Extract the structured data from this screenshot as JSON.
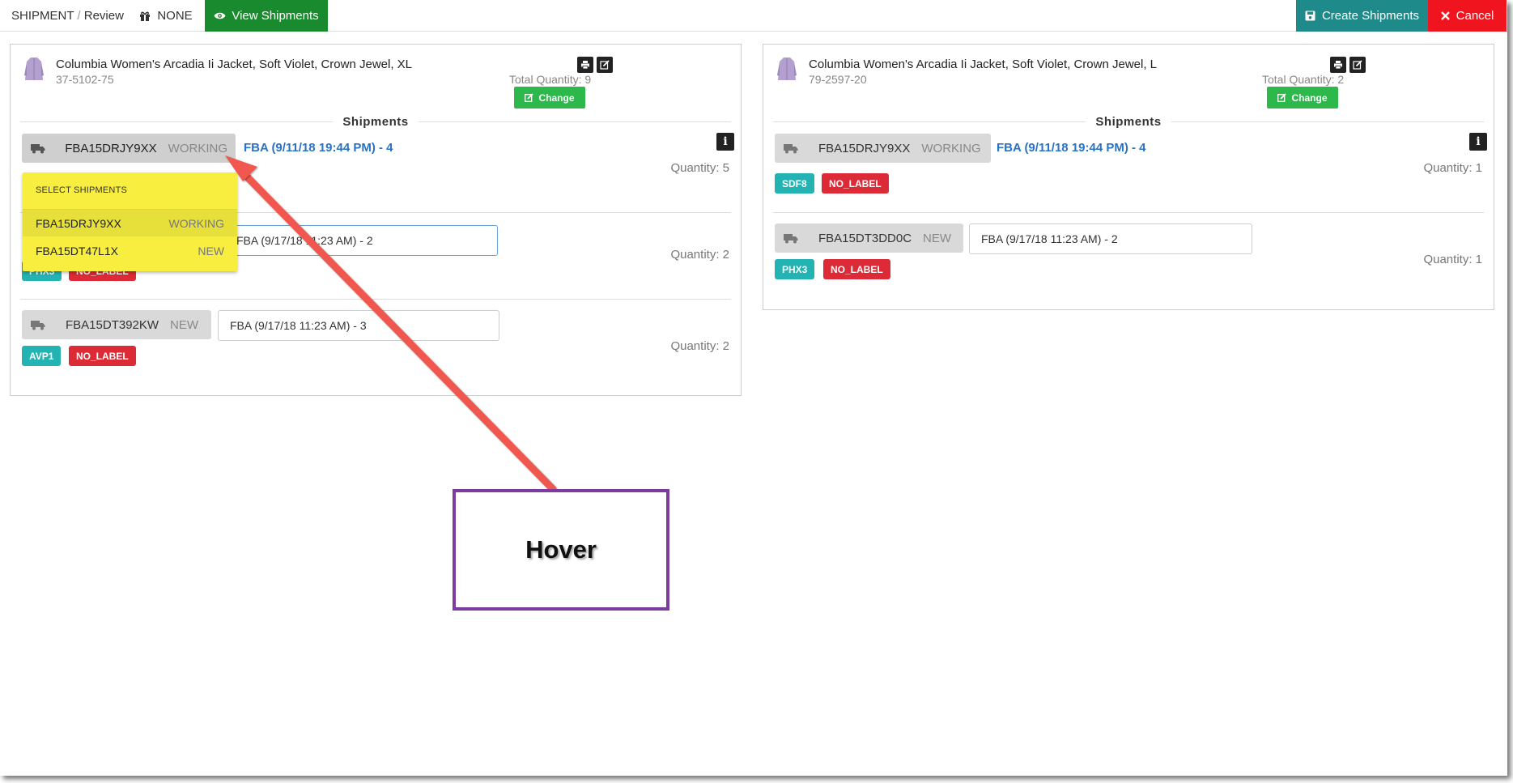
{
  "topbar": {
    "crumb_root": "SHIPMENT",
    "crumb_sep": "/",
    "crumb_current": "Review",
    "none_label": "NONE",
    "view_label": "View Shipments",
    "create_label": "Create Shipments",
    "cancel_label": "Cancel"
  },
  "panels": [
    {
      "title": "Columbia Women's Arcadia Ii Jacket, Soft Violet, Crown Jewel, XL",
      "sku": "37-5102-75",
      "total_qty": "Total Quantity: 9",
      "change_label": "Change",
      "section": "Shipments",
      "rows": [
        {
          "id": "FBA15DRJY9XX",
          "status": "WORKING",
          "link": "FBA (9/11/18 19:44 PM) - 4",
          "qty": "Quantity: 5",
          "tags": []
        },
        {
          "id": "",
          "status": "",
          "input": "FBA (9/17/18 11:23 AM) - 2",
          "qty": "Quantity: 2",
          "tags": [
            "PHX3",
            "NO_LABEL"
          ]
        },
        {
          "id": "FBA15DT392KW",
          "status": "NEW",
          "input": "FBA (9/17/18 11:23 AM) - 3",
          "qty": "Quantity: 2",
          "tags": [
            "AVP1",
            "NO_LABEL"
          ]
        }
      ]
    },
    {
      "title": "Columbia Women's Arcadia Ii Jacket, Soft Violet, Crown Jewel, L",
      "sku": "79-2597-20",
      "total_qty": "Total Quantity: 2",
      "change_label": "Change",
      "section": "Shipments",
      "rows": [
        {
          "id": "FBA15DRJY9XX",
          "status": "WORKING",
          "link": "FBA (9/11/18 19:44 PM) - 4",
          "qty": "Quantity: 1",
          "tags": [
            "SDF8",
            "NO_LABEL"
          ]
        },
        {
          "id": "FBA15DT3DD0C",
          "status": "NEW",
          "input": "FBA (9/17/18 11:23 AM) - 2",
          "qty": "Quantity: 1",
          "tags": [
            "PHX3",
            "NO_LABEL"
          ]
        }
      ]
    }
  ],
  "dropdown": {
    "header": "SELECT SHIPMENTS",
    "items": [
      {
        "id": "FBA15DRJY9XX",
        "status": "WORKING"
      },
      {
        "id": "FBA15DT47L1X",
        "status": "NEW"
      }
    ]
  },
  "annotation": {
    "label": "Hover"
  },
  "colors": {
    "green": "#1a8a2e",
    "teal": "#1e8a8a",
    "red": "#f0141e",
    "dropdown": "#f7ee40",
    "annotation_border": "#7d3b9e",
    "arrow": "#f0584f"
  }
}
